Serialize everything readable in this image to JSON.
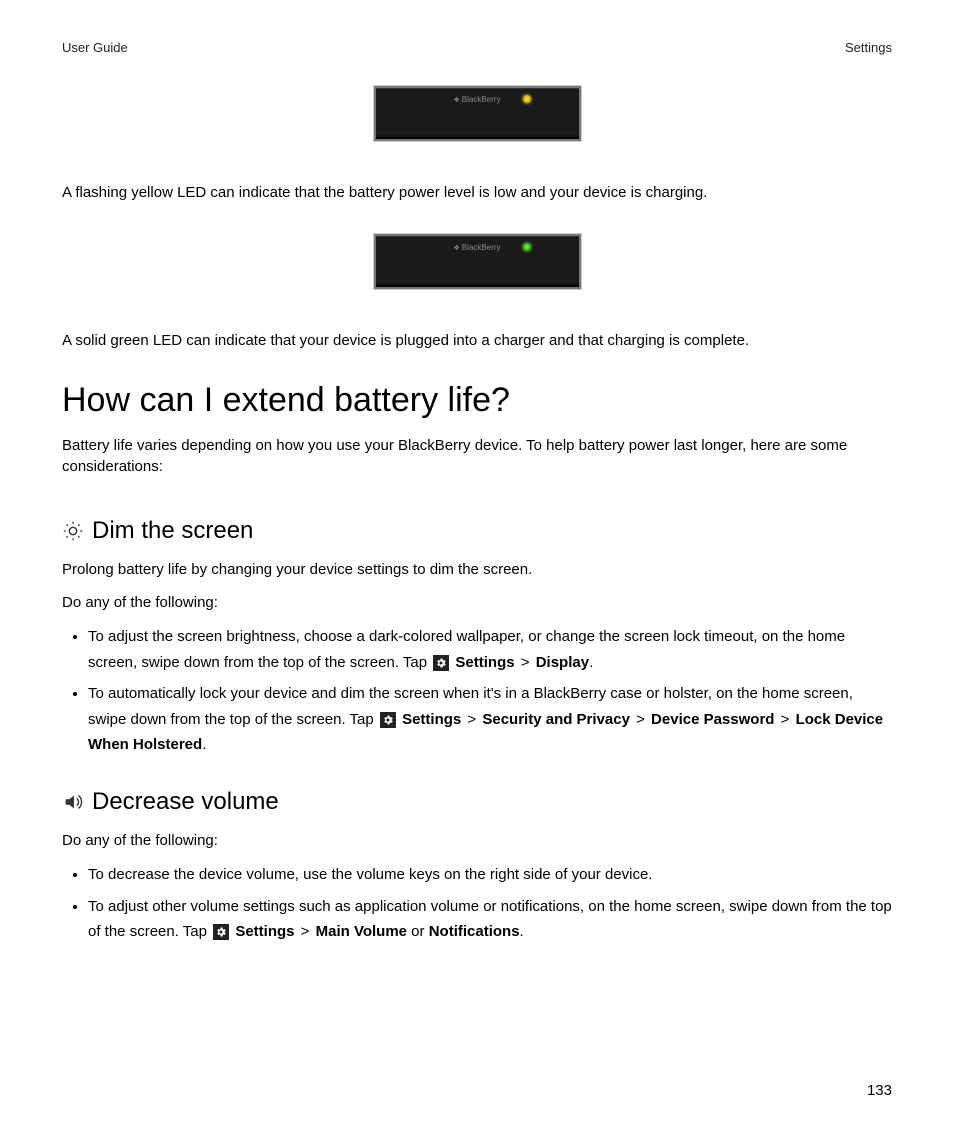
{
  "header": {
    "left": "User Guide",
    "right": "Settings"
  },
  "device_brand": "BlackBerry",
  "yellow_led_text": "A flashing yellow LED can indicate that the battery power level is low and your device is charging.",
  "green_led_text": "A solid green LED can indicate that your device is plugged into a charger and that charging is complete.",
  "main_heading": "How can I extend battery life?",
  "main_intro": "Battery life varies depending on how you use your BlackBerry device. To help battery power last longer, here are some considerations:",
  "dim": {
    "heading": "Dim the screen",
    "p1": "Prolong battery life by changing your device settings to dim the screen.",
    "p2": "Do any of the following:",
    "li1_pre": "To adjust the screen brightness, choose a dark-colored wallpaper, or change the screen lock timeout, on the home screen, swipe down from the top of the screen. Tap ",
    "li1_b1": "Settings",
    "li1_b2": "Display",
    "li2_pre": "To automatically lock your device and dim the screen when it's in a BlackBerry case or holster, on the home screen, swipe down from the top of the screen. Tap ",
    "li2_b1": "Settings",
    "li2_b2": "Security and Privacy",
    "li2_b3": "Device Password",
    "li2_b4": "Lock Device When Holstered"
  },
  "volume": {
    "heading": "Decrease volume",
    "p1": "Do any of the following:",
    "li1": "To decrease the device volume, use the volume keys on the right side of your device.",
    "li2_pre": "To adjust other volume settings such as application volume or notifications, on the home screen, swipe down from the top of the screen. Tap ",
    "li2_b1": "Settings",
    "li2_b2": "Main Volume",
    "li2_or": " or ",
    "li2_b3": "Notifications"
  },
  "separator": ">",
  "period": ".",
  "page_number": "133"
}
